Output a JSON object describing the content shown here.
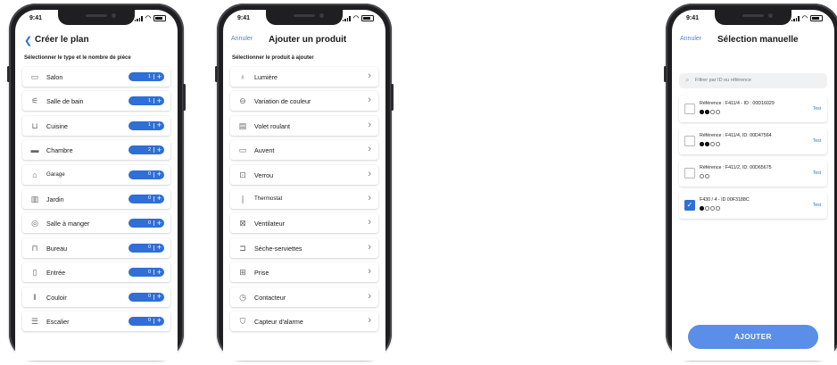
{
  "status": {
    "time": "9:41"
  },
  "screen1": {
    "back_icon": "chevron-left-icon",
    "title": "Créer le plan",
    "subtitle": "Sélectionner le type et le nombre de pièce",
    "rooms": [
      {
        "label": "Salon",
        "count": "1",
        "icon": "sofa-icon"
      },
      {
        "label": "Salle de bain",
        "count": "1",
        "icon": "shower-icon"
      },
      {
        "label": "Cuisine",
        "count": "1",
        "icon": "pot-icon"
      },
      {
        "label": "Chambre",
        "count": "2",
        "icon": "bed-icon"
      },
      {
        "label": "Garage",
        "count": "0",
        "icon": "garage-icon"
      },
      {
        "label": "Jardin",
        "count": "0",
        "icon": "fence-icon"
      },
      {
        "label": "Salle à manger",
        "count": "0",
        "icon": "dining-icon"
      },
      {
        "label": "Bureau",
        "count": "0",
        "icon": "desk-icon"
      },
      {
        "label": "Entrée",
        "count": "0",
        "icon": "door-icon"
      },
      {
        "label": "Couloir",
        "count": "0",
        "icon": "corridor-icon"
      },
      {
        "label": "Escalier",
        "count": "0",
        "icon": "stairs-icon"
      }
    ]
  },
  "screen2": {
    "cancel": "Annuler",
    "title": "Ajouter un produit",
    "subtitle": "Sélectionner le produit à ajouter",
    "products": [
      {
        "label": "Lumière",
        "icon": "bulb-icon"
      },
      {
        "label": "Variation de couleur",
        "icon": "color-wheel-icon"
      },
      {
        "label": "Volet roulant",
        "icon": "shutter-icon"
      },
      {
        "label": "Auvent",
        "icon": "awning-icon"
      },
      {
        "label": "Verrou",
        "icon": "lock-icon"
      },
      {
        "label": "Thermostat",
        "icon": "thermostat-icon"
      },
      {
        "label": "Ventilateur",
        "icon": "fan-icon"
      },
      {
        "label": "Sèche-serviettes",
        "icon": "towel-dryer-icon"
      },
      {
        "label": "Prise",
        "icon": "outlet-icon"
      },
      {
        "label": "Contacteur",
        "icon": "contactor-icon"
      },
      {
        "label": "Capteur d'alarme",
        "icon": "shield-icon"
      }
    ]
  },
  "screen3": {
    "cancel": "Annuler",
    "title": "Sélection manuelle",
    "search_placeholder": "Filtrer par ID ou référence",
    "devices": [
      {
        "ref": "Référence : F411/4 - ID : 00D16029",
        "checked": false,
        "dots": [
          1,
          1,
          0,
          0
        ],
        "test": "Test"
      },
      {
        "ref": "Référence : F411/4, ID: 00D47564",
        "checked": false,
        "dots": [
          1,
          1,
          0,
          0
        ],
        "test": "Test"
      },
      {
        "ref": "Référence : F411/2, ID: 00D65675",
        "checked": false,
        "dots": [
          0,
          0
        ],
        "test": "Test"
      },
      {
        "ref": "F430 / 4 - ID 00F3188C",
        "checked": true,
        "dots": [
          1,
          0,
          0,
          0
        ],
        "test": "Test"
      }
    ],
    "add_button": "AJOUTER"
  }
}
